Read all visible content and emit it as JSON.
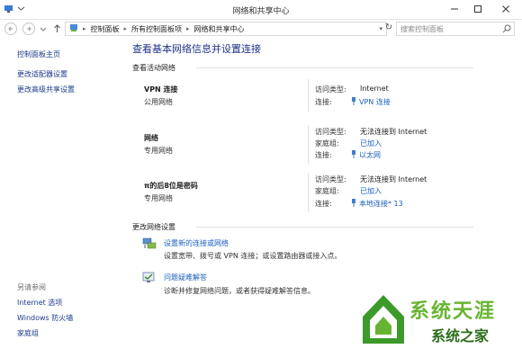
{
  "window": {
    "title": "网络和共享中心"
  },
  "address": {
    "path": [
      "控制面板",
      "所有控制面板项",
      "网络和共享中心"
    ],
    "search_placeholder": "搜索控制面板"
  },
  "sidebar": {
    "top_links": [
      "控制面板主页",
      "更改适配器设置",
      "更改高级共享设置"
    ],
    "see_also_heading": "另请参阅",
    "see_also_links": [
      "Internet 选项",
      "Windows 防火墙",
      "家庭组"
    ]
  },
  "main": {
    "title": "查看基本网络信息并设置连接",
    "active_heading": "查看活动网络",
    "networks": [
      {
        "name": "VPN 连接",
        "type": "公用网络",
        "rows": [
          {
            "label": "访问类型:",
            "value": "Internet",
            "link": false
          },
          {
            "label": "连接:",
            "value": "VPN 连接",
            "link": true
          }
        ]
      },
      {
        "name": "网络",
        "type": "专用网络",
        "rows": [
          {
            "label": "访问类型:",
            "value": "无法连接到 Internet",
            "link": false
          },
          {
            "label": "家庭组:",
            "value": "已加入",
            "link": true
          },
          {
            "label": "连接:",
            "value": "以太网",
            "link": true
          }
        ]
      },
      {
        "name": "π的后8位是密码",
        "type": "专用网络",
        "rows": [
          {
            "label": "访问类型:",
            "value": "无法连接到 Internet",
            "link": false
          },
          {
            "label": "家庭组:",
            "value": "已加入",
            "link": true
          },
          {
            "label": "连接:",
            "value": "本地连接* 13",
            "link": true
          }
        ]
      }
    ],
    "change_heading": "更改网络设置",
    "settings": [
      {
        "link": "设置新的连接或网络",
        "desc": "设置宽带、拨号或 VPN 连接；或设置路由器或接入点。"
      },
      {
        "link": "问题疑难解答",
        "desc": "诊断并修复网络问题，或者获得疑难解答信息。"
      }
    ]
  },
  "watermark": {
    "text": "系统之家",
    "big_text": "系统天涯"
  },
  "colors": {
    "link": "#1a5fbf",
    "title": "#1e3287",
    "watermark_green": "#2c6e1c"
  }
}
